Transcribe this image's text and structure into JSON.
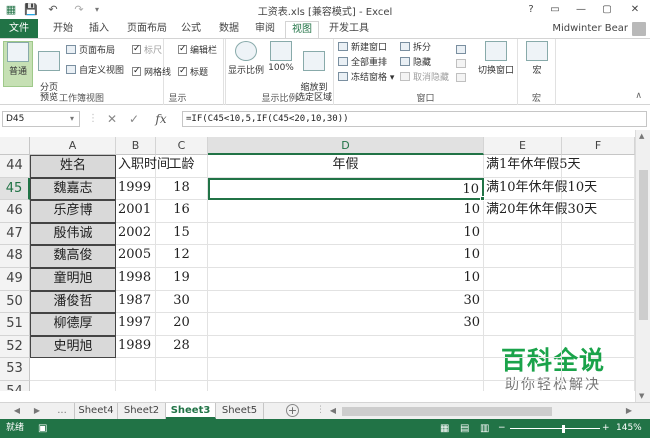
{
  "window": {
    "title": "工资表.xls  [兼容模式] - Excel",
    "help": "?",
    "ribbon_options": "▭",
    "minimize": "—",
    "maximize": "▢",
    "close": "✕"
  },
  "quick_access": {
    "app_icon": "excel-icon",
    "save": "save-icon",
    "undo": "undo-icon",
    "redo": "redo-icon"
  },
  "ribbon_tabs": {
    "file": "文件",
    "items": [
      "开始",
      "插入",
      "页面布局",
      "公式",
      "数据",
      "审阅",
      "视图",
      "开发工具"
    ],
    "active": "视图"
  },
  "user": {
    "name": "Midwinter Bear"
  },
  "ribbon": {
    "workbook_views": {
      "label": "工作簿视图",
      "normal": "普通",
      "page_break": "分页\n预览",
      "page_layout": "页面布局",
      "custom_views": "自定义视图"
    },
    "show": {
      "label": "显示",
      "ruler": "标尺",
      "gridlines": "网格线",
      "formula_bar": "编辑栏",
      "headings": "标题"
    },
    "zoom": {
      "label": "显示比例",
      "zoom": "显示比例",
      "hundred": "100%",
      "zoom_selection": "缩放到\n选定区域"
    },
    "window": {
      "label": "窗口",
      "new_window": "新建窗口",
      "arrange_all": "全部重排",
      "freeze_panes": "冻结窗格",
      "split": "拆分",
      "hide": "隐藏",
      "unhide": "取消隐藏",
      "switch_windows": "切换窗口"
    },
    "macros": {
      "label": "宏",
      "macros": "宏"
    }
  },
  "formula_bar": {
    "name_box": "D45",
    "cancel": "✕",
    "enter": "✓",
    "fx": "fx",
    "formula": "=IF(C45<10,5,IF(C45<20,10,30))"
  },
  "sheet": {
    "columns": [
      "A",
      "B",
      "C",
      "D",
      "E",
      "F"
    ],
    "selected_column": "D",
    "rows": [
      {
        "num": "44",
        "a": "姓名",
        "b": "入职时间",
        "c": "工龄",
        "d": "年假",
        "e": "满1年休年假5天"
      },
      {
        "num": "45",
        "a": "魏嘉志",
        "b": "1999",
        "c": "18",
        "d": "10",
        "e": "满10年休年假10天"
      },
      {
        "num": "46",
        "a": "乐彦博",
        "b": "2001",
        "c": "16",
        "d": "10",
        "e": "满20年休年假30天"
      },
      {
        "num": "47",
        "a": "殷伟诚",
        "b": "2002",
        "c": "15",
        "d": "10",
        "e": ""
      },
      {
        "num": "48",
        "a": "魏高俊",
        "b": "2005",
        "c": "12",
        "d": "10",
        "e": ""
      },
      {
        "num": "49",
        "a": "童明旭",
        "b": "1998",
        "c": "19",
        "d": "10",
        "e": ""
      },
      {
        "num": "50",
        "a": "潘俊哲",
        "b": "1987",
        "c": "30",
        "d": "30",
        "e": ""
      },
      {
        "num": "51",
        "a": "柳德厚",
        "b": "1997",
        "c": "20",
        "d": "30",
        "e": ""
      },
      {
        "num": "52",
        "a": "史明旭",
        "b": "1989",
        "c": "28",
        "d": "",
        "e": ""
      },
      {
        "num": "53",
        "a": "",
        "b": "",
        "c": "",
        "d": "",
        "e": ""
      },
      {
        "num": "54",
        "a": "",
        "b": "",
        "c": "",
        "d": "",
        "e": ""
      }
    ]
  },
  "sheet_tabs": {
    "ellipsis": "...",
    "tabs": [
      "Sheet4",
      "Sheet2",
      "Sheet3",
      "Sheet5"
    ],
    "active": "Sheet3",
    "add": "+"
  },
  "status": {
    "ready": "就绪",
    "zoom": "145%"
  },
  "watermark": {
    "title": "百科全说",
    "subtitle": "助你轻松解决"
  }
}
